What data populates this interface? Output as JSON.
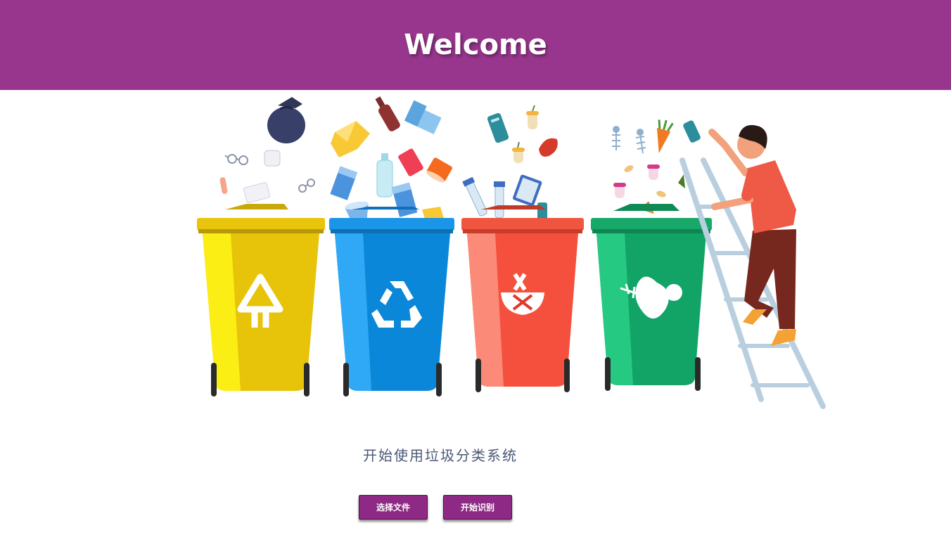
{
  "header": {
    "title": "Welcome"
  },
  "main": {
    "subtitle": "开始使用垃圾分类系统",
    "buttons": {
      "select_file": "选择文件",
      "start_recognition": "开始识别"
    }
  },
  "colors": {
    "header_bg": "#98368d",
    "button_bg": "#8e2a85",
    "bin_yellow": "#f2cf0a",
    "bin_blue": "#1693e6",
    "bin_red": "#f4503c",
    "bin_green": "#16ac6e"
  },
  "illustration": {
    "bins": [
      {
        "color": "yellow",
        "icon": "hazardous-waste-icon"
      },
      {
        "color": "blue",
        "icon": "recycle-icon"
      },
      {
        "color": "red",
        "icon": "no-food-waste-icon"
      },
      {
        "color": "green",
        "icon": "food-waste-icon"
      }
    ]
  }
}
